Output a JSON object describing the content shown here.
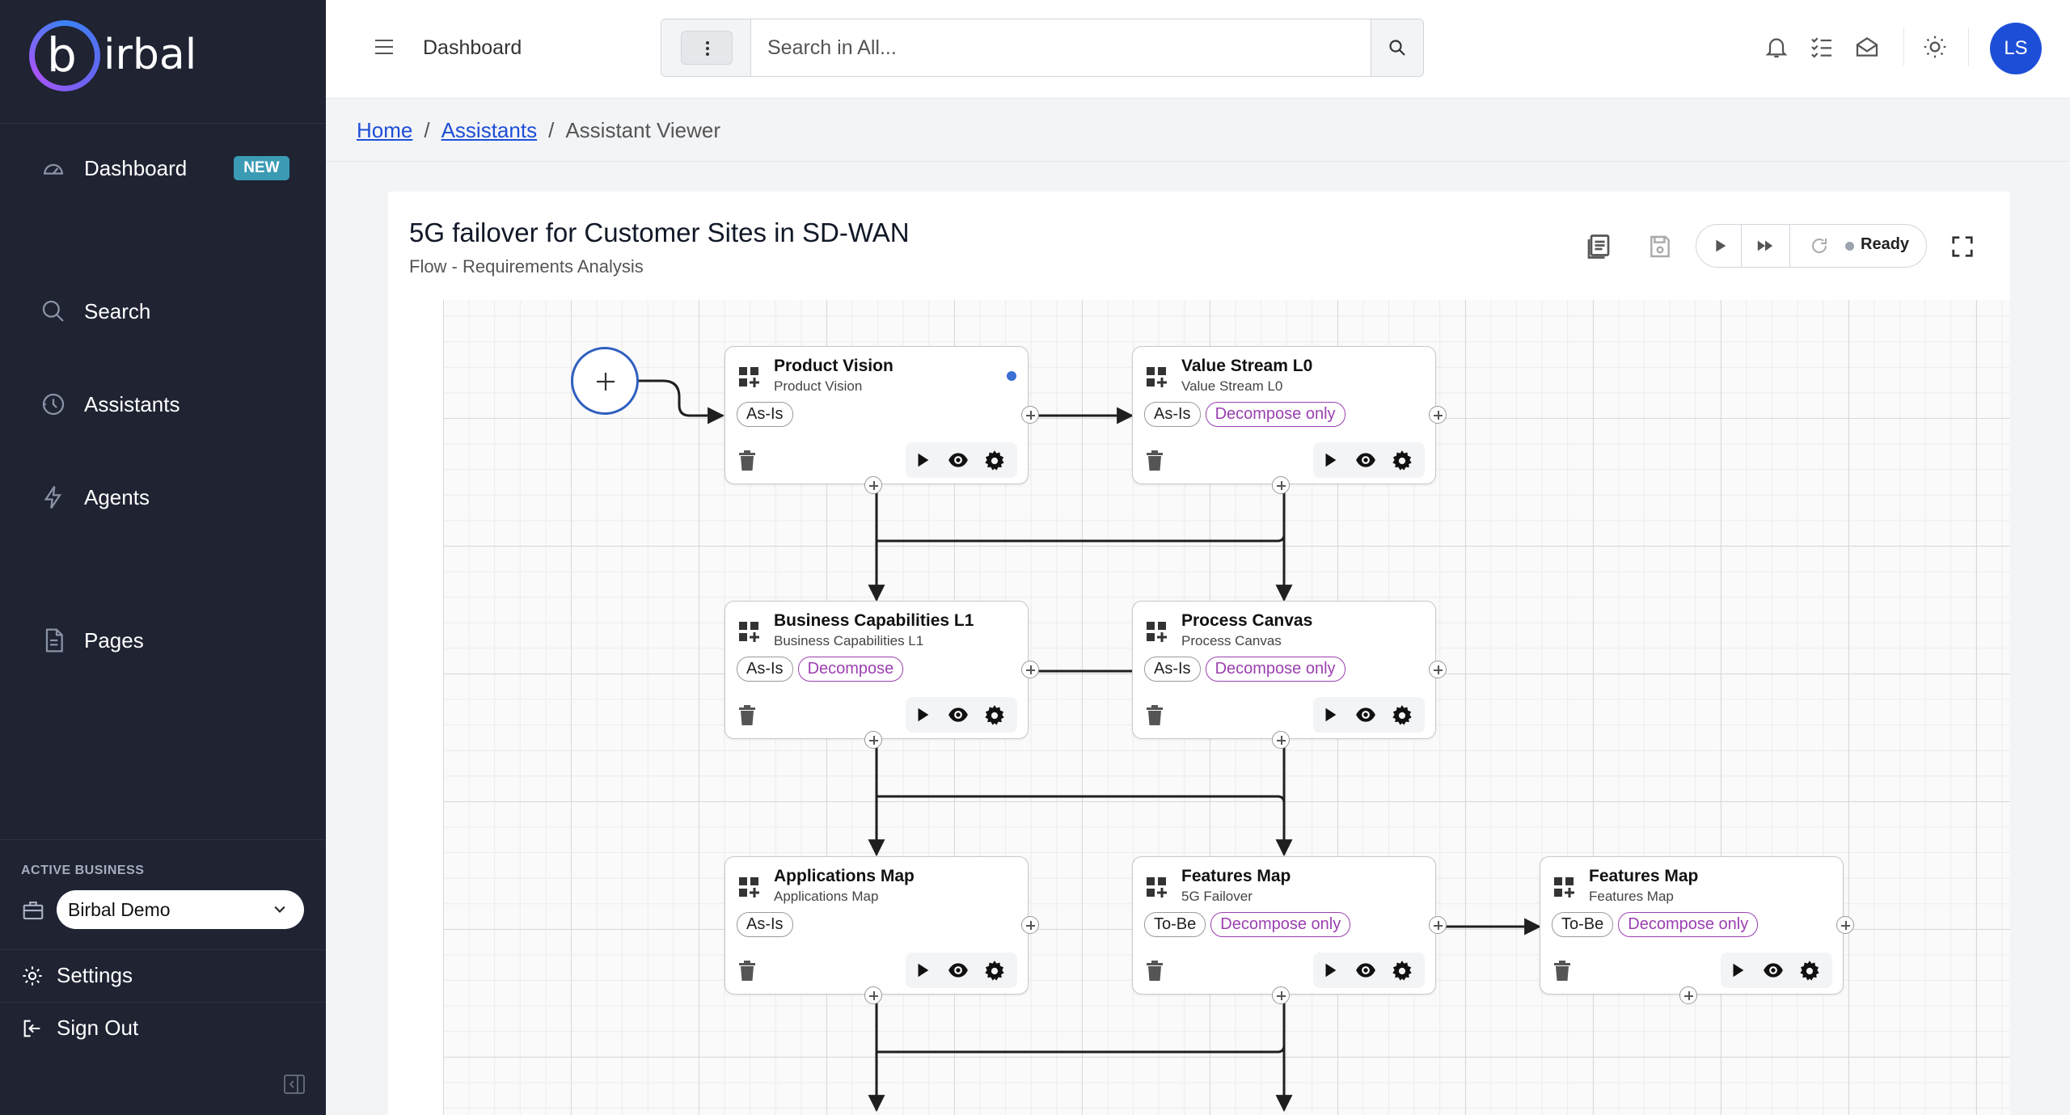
{
  "sidebar": {
    "brand": {
      "logo_letter": "b",
      "logo_text": "irbal"
    },
    "nav": [
      {
        "label": "Dashboard",
        "badge": "NEW",
        "icon": "gauge-icon"
      },
      {
        "label": "Search",
        "icon": "search-icon"
      },
      {
        "label": "Assistants",
        "icon": "history-icon"
      },
      {
        "label": "Agents",
        "icon": "bolt-icon"
      },
      {
        "label": "Pages",
        "icon": "document-icon"
      }
    ],
    "active_business": {
      "label": "ACTIVE BUSINESS",
      "value": "Birbal Demo"
    },
    "settings_label": "Settings",
    "signout_label": "Sign Out"
  },
  "topbar": {
    "page_name": "Dashboard",
    "search_placeholder": "Search in All...",
    "avatar_initials": "LS"
  },
  "breadcrumb": {
    "home": "Home",
    "assistants": "Assistants",
    "current": "Assistant Viewer"
  },
  "flow": {
    "title": "5G failover for Customer Sites in SD-WAN",
    "subtitle": "Flow - Requirements Analysis",
    "status": "Ready",
    "nodes": [
      {
        "title": "Product Vision",
        "subtitle": "Product Vision",
        "tags": [
          "As-Is"
        ],
        "active": true
      },
      {
        "title": "Value Stream L0",
        "subtitle": "Value Stream L0",
        "tags": [
          "As-Is",
          "Decompose only"
        ]
      },
      {
        "title": "Business Capabilities L1",
        "subtitle": "Business Capabilities L1",
        "tags": [
          "As-Is",
          "Decompose"
        ]
      },
      {
        "title": "Process Canvas",
        "subtitle": "Process Canvas",
        "tags": [
          "As-Is",
          "Decompose only"
        ]
      },
      {
        "title": "Applications Map",
        "subtitle": "Applications Map",
        "tags": [
          "As-Is"
        ]
      },
      {
        "title": "Features Map",
        "subtitle": "5G Failover",
        "tags": [
          "To-Be",
          "Decompose only"
        ]
      },
      {
        "title": "Features Map",
        "subtitle": "Features Map",
        "tags": [
          "To-Be",
          "Decompose only"
        ]
      }
    ]
  }
}
